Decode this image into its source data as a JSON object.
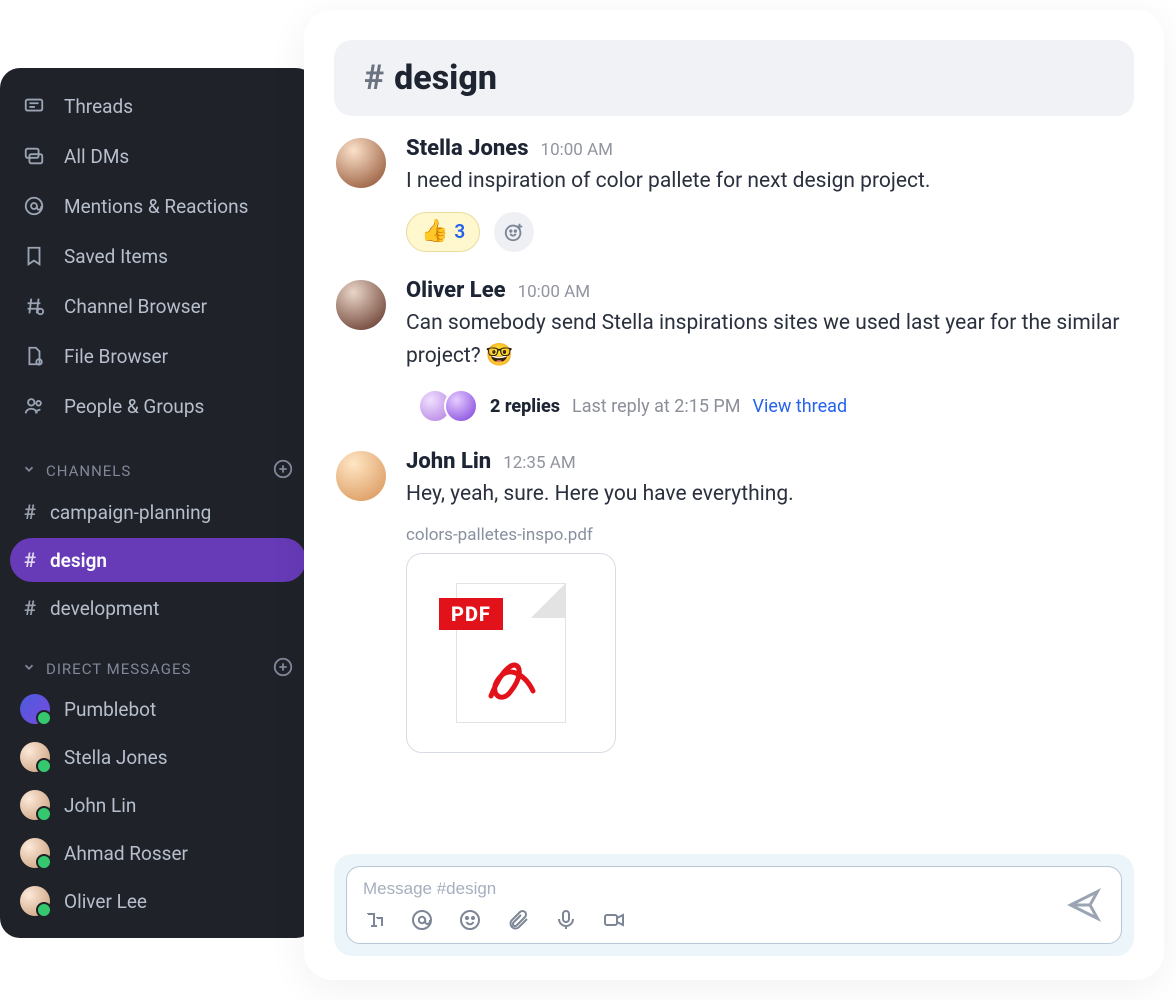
{
  "sidebar": {
    "nav": [
      {
        "label": "Threads"
      },
      {
        "label": "All DMs"
      },
      {
        "label": "Mentions & Reactions"
      },
      {
        "label": "Saved Items"
      },
      {
        "label": "Channel Browser"
      },
      {
        "label": "File Browser"
      },
      {
        "label": "People & Groups"
      }
    ],
    "channelsHeader": "CHANNELS",
    "channels": [
      {
        "name": "campaign-planning",
        "active": false
      },
      {
        "name": "design",
        "active": true
      },
      {
        "name": "development",
        "active": false
      }
    ],
    "dmHeader": "DIRECT MESSAGES",
    "dms": [
      {
        "name": "Pumblebot",
        "online": false,
        "bot": true
      },
      {
        "name": "Stella Jones",
        "online": true
      },
      {
        "name": "John Lin",
        "online": true
      },
      {
        "name": "Ahmad Rosser",
        "online": true
      },
      {
        "name": "Oliver Lee",
        "online": true
      }
    ]
  },
  "channel": {
    "hash": "#",
    "name": "design"
  },
  "messages": [
    {
      "author": "Stella Jones",
      "time": "10:00 AM",
      "text": "I need inspiration of color pallete for next design project.",
      "reactions": [
        {
          "emoji": "👍",
          "count": 3
        }
      ],
      "showAddReaction": true
    },
    {
      "author": "Oliver Lee",
      "time": "10:00 AM",
      "text": "Can somebody send Stella inspirations sites we used last year for the similar project? ",
      "trailingEmoji": "🤓",
      "thread": {
        "replies": "2 replies",
        "lastReply": "Last reply at 2:15 PM",
        "link": "View thread"
      }
    },
    {
      "author": "John Lin",
      "time": "12:35 AM",
      "text": "Hey, yeah, sure. Here you have everything.",
      "file": {
        "name": "colors-palletes-inspo.pdf",
        "badge": "PDF"
      }
    }
  ],
  "composer": {
    "placeholder": "Message #design"
  }
}
